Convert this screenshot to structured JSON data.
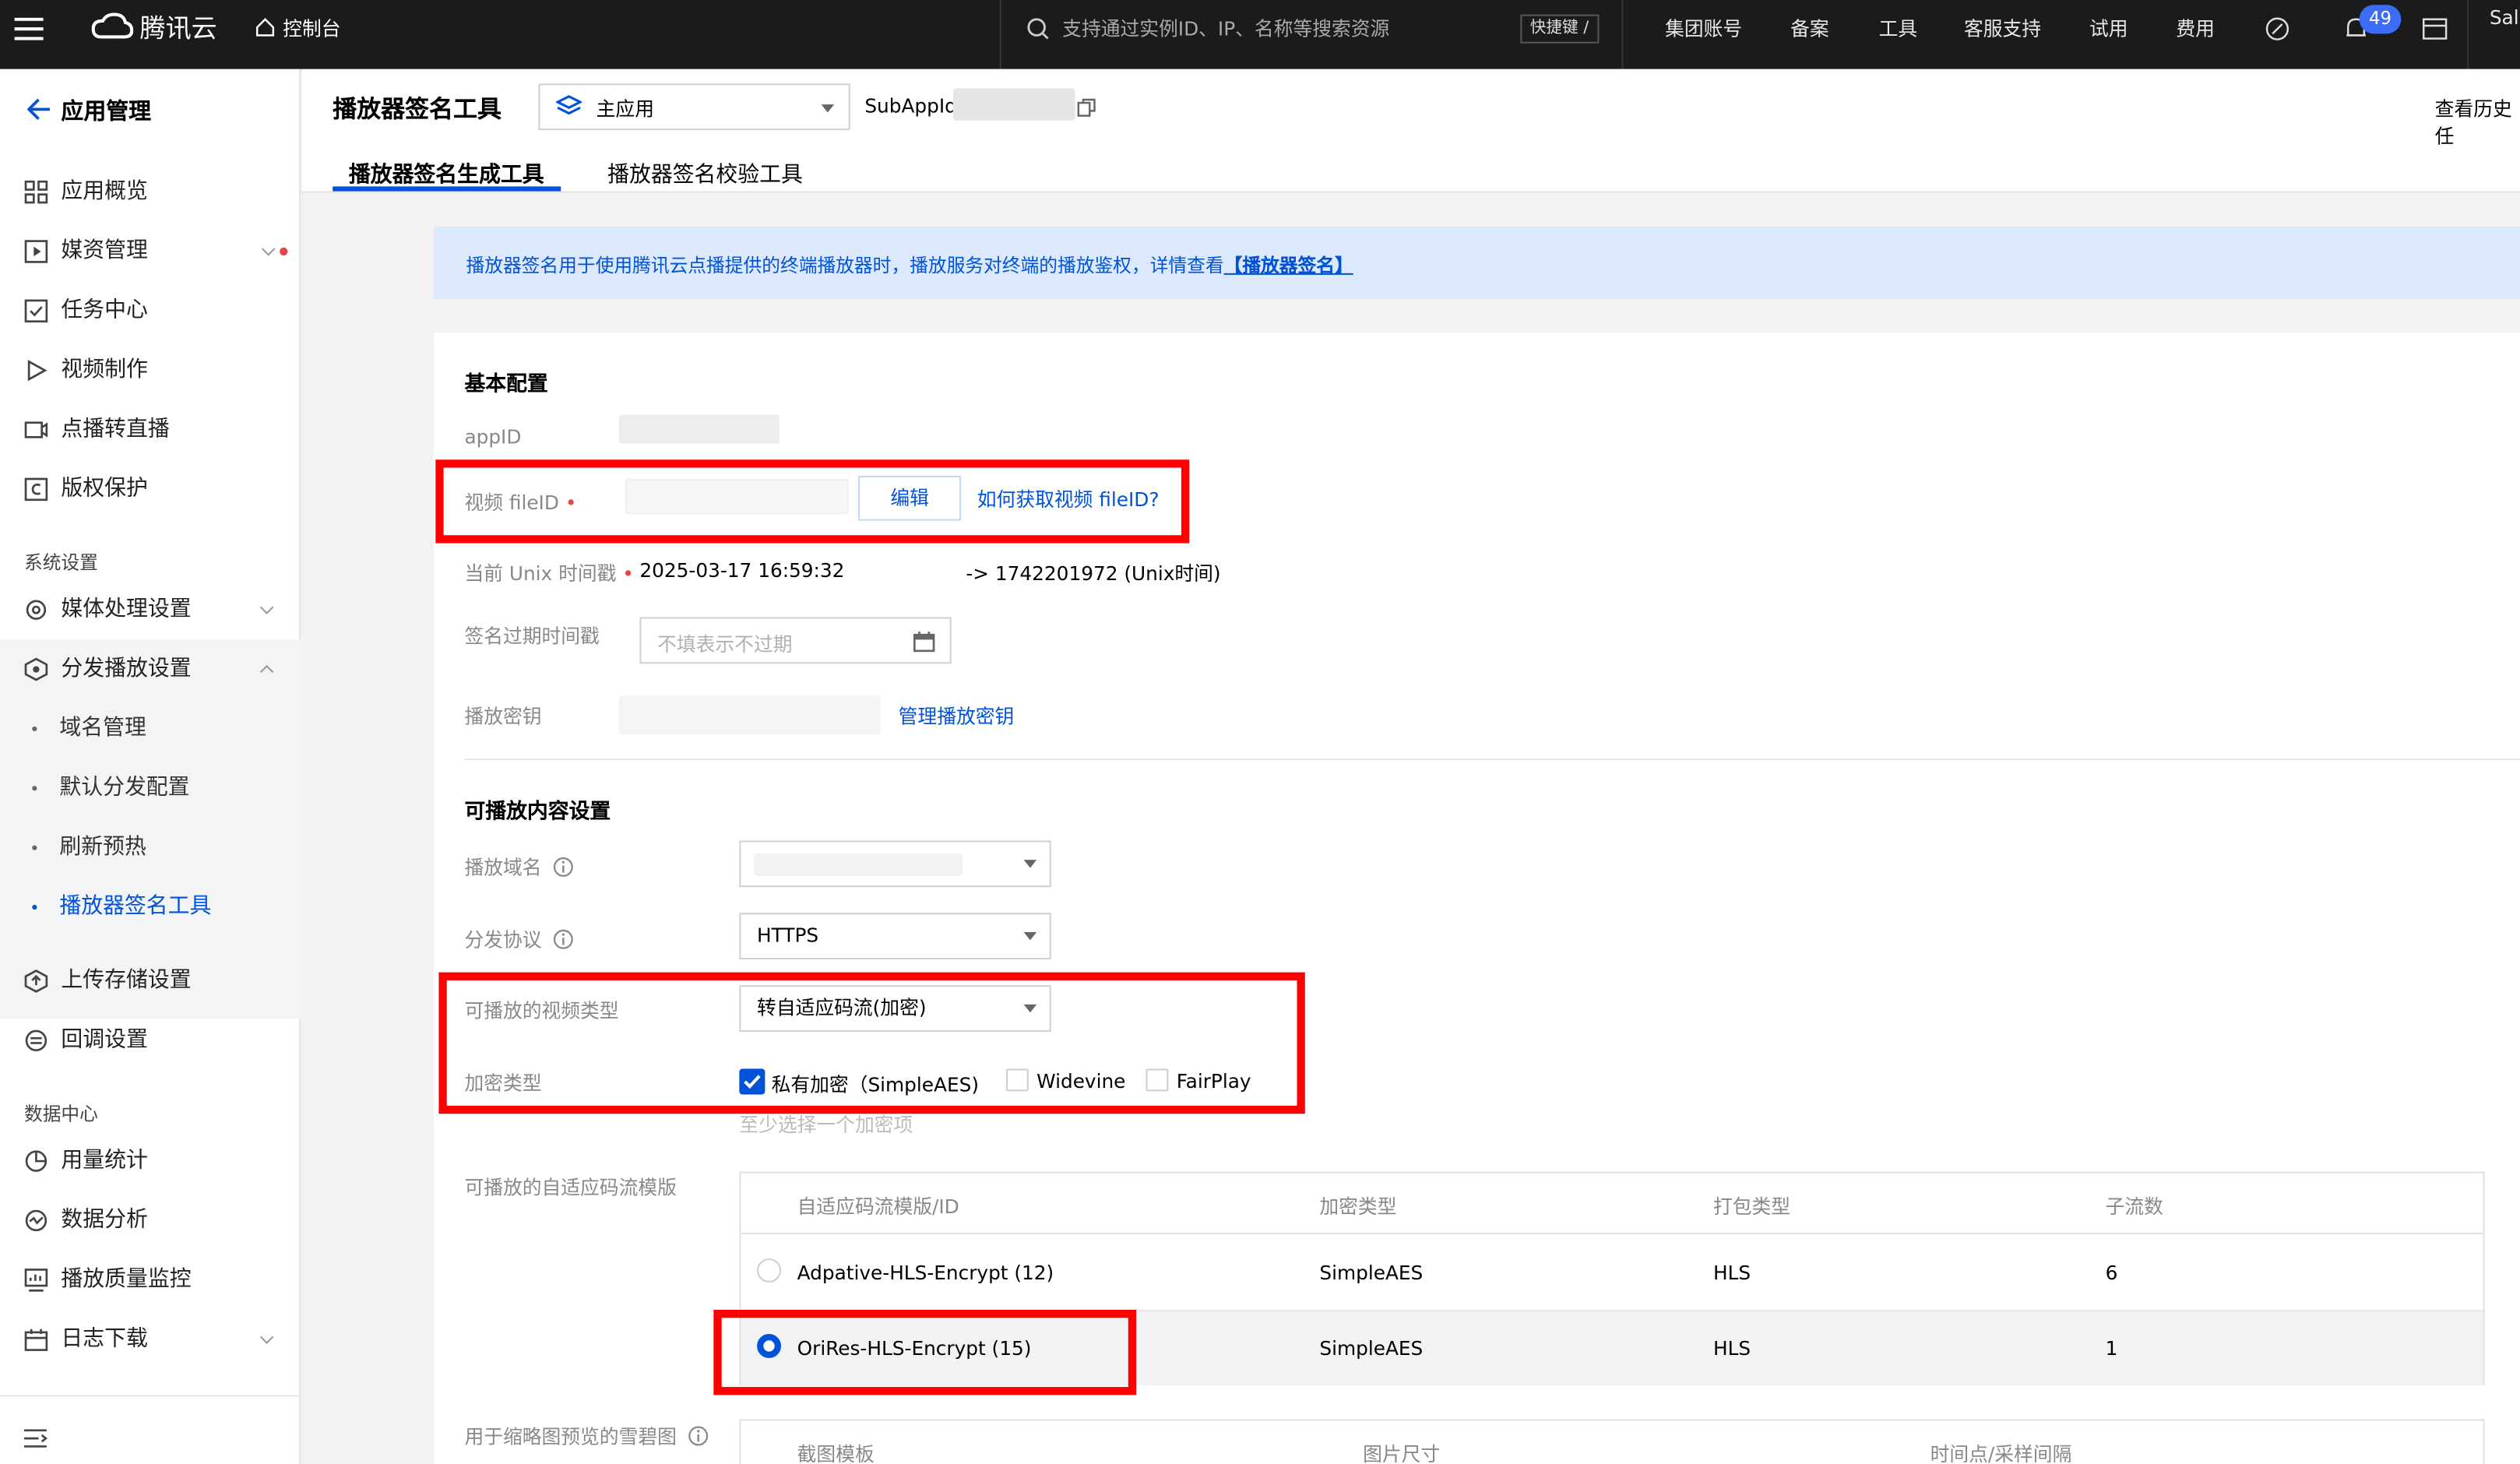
{
  "topbar": {
    "brand": "腾讯云",
    "console": "控制台",
    "search_placeholder": "支持通过实例ID、IP、名称等搜索资源",
    "shortcut": "快捷键 /",
    "menu": [
      "集团账号",
      "备案",
      "工具",
      "客服支持",
      "试用",
      "费用"
    ],
    "notifications": "49",
    "user_partial": "Sal"
  },
  "sidebar": {
    "back_label": "应用管理",
    "items": [
      {
        "label": "应用概览",
        "icon": "grid-icon"
      },
      {
        "label": "媒资管理",
        "icon": "media-icon"
      },
      {
        "label": "任务中心",
        "icon": "task-icon"
      },
      {
        "label": "视频制作",
        "icon": "play-icon"
      },
      {
        "label": "点播转直播",
        "icon": "live-icon"
      },
      {
        "label": "版权保护",
        "icon": "copyright-icon"
      }
    ],
    "group_system": "系统设置",
    "system_items": [
      {
        "label": "媒体处理设置",
        "icon": "media-settings-icon"
      },
      {
        "label": "分发播放设置",
        "icon": "distribution-icon"
      }
    ],
    "sub_items": [
      "域名管理",
      "默认分发配置",
      "刷新预热",
      "播放器签名工具"
    ],
    "after_items": [
      {
        "label": "上传存储设置",
        "icon": "upload-icon"
      },
      {
        "label": "回调设置",
        "icon": "callback-icon"
      }
    ],
    "group_data": "数据中心",
    "data_items": [
      {
        "label": "用量统计",
        "icon": "pie-icon"
      },
      {
        "label": "数据分析",
        "icon": "analysis-icon"
      },
      {
        "label": "播放质量监控",
        "icon": "monitor-icon"
      },
      {
        "label": "日志下载",
        "icon": "calendar-icon"
      }
    ]
  },
  "header": {
    "title": "播放器签名工具",
    "app_select": "主应用",
    "subappid_label": "SubAppId:",
    "history": "查看历史任",
    "tabs": [
      "播放器签名生成工具",
      "播放器签名校验工具"
    ]
  },
  "notice": {
    "text": "播放器签名用于使用腾讯云点播提供的终端播放器时，播放服务对终端的播放鉴权，详情查看",
    "link": "【播放器签名】"
  },
  "basic": {
    "title": "基本配置",
    "appid_label": "appID",
    "fileid_label": "视频 fileID",
    "edit_button": "编辑",
    "fileid_help": "如何获取视频 fileID?",
    "unix_label": "当前 Unix 时间戳",
    "unix_datetime": "2025-03-17 16:59:32",
    "unix_value": "-> 1742201972 (Unix时间)",
    "expire_label": "签名过期时间戳",
    "expire_placeholder": "不填表示不过期",
    "key_label": "播放密钥",
    "key_link": "管理播放密钥"
  },
  "playable": {
    "title": "可播放内容设置",
    "domain_label": "播放域名",
    "protocol_label": "分发协议",
    "protocol_value": "HTTPS",
    "video_type_label": "可播放的视频类型",
    "video_type_value": "转自适应码流(加密)",
    "encrypt_label": "加密类型",
    "encrypt_options": [
      {
        "label": "私有加密（SimpleAES)",
        "checked": true
      },
      {
        "label": "Widevine",
        "checked": false
      },
      {
        "label": "FairPlay",
        "checked": false
      }
    ],
    "encrypt_hint": "至少选择一个加密项",
    "template_label": "可播放的自适应码流模版",
    "table_headers": [
      "自适应码流模版/ID",
      "加密类型",
      "打包类型",
      "子流数"
    ],
    "rows": [
      {
        "name": "Adpative-HLS-Encrypt (12)",
        "enc": "SimpleAES",
        "pack": "HLS",
        "count": "6",
        "selected": false
      },
      {
        "name": "OriRes-HLS-Encrypt (15)",
        "enc": "SimpleAES",
        "pack": "HLS",
        "count": "1",
        "selected": true
      }
    ],
    "sprite_label": "用于缩略图预览的雪碧图",
    "sprite_headers": [
      "截图模板",
      "图片尺寸",
      "时间点/采样间隔"
    ]
  },
  "colors": {
    "accent": "#0052d9",
    "highlight": "#ff0000",
    "topbar": "#1b1b1b"
  }
}
